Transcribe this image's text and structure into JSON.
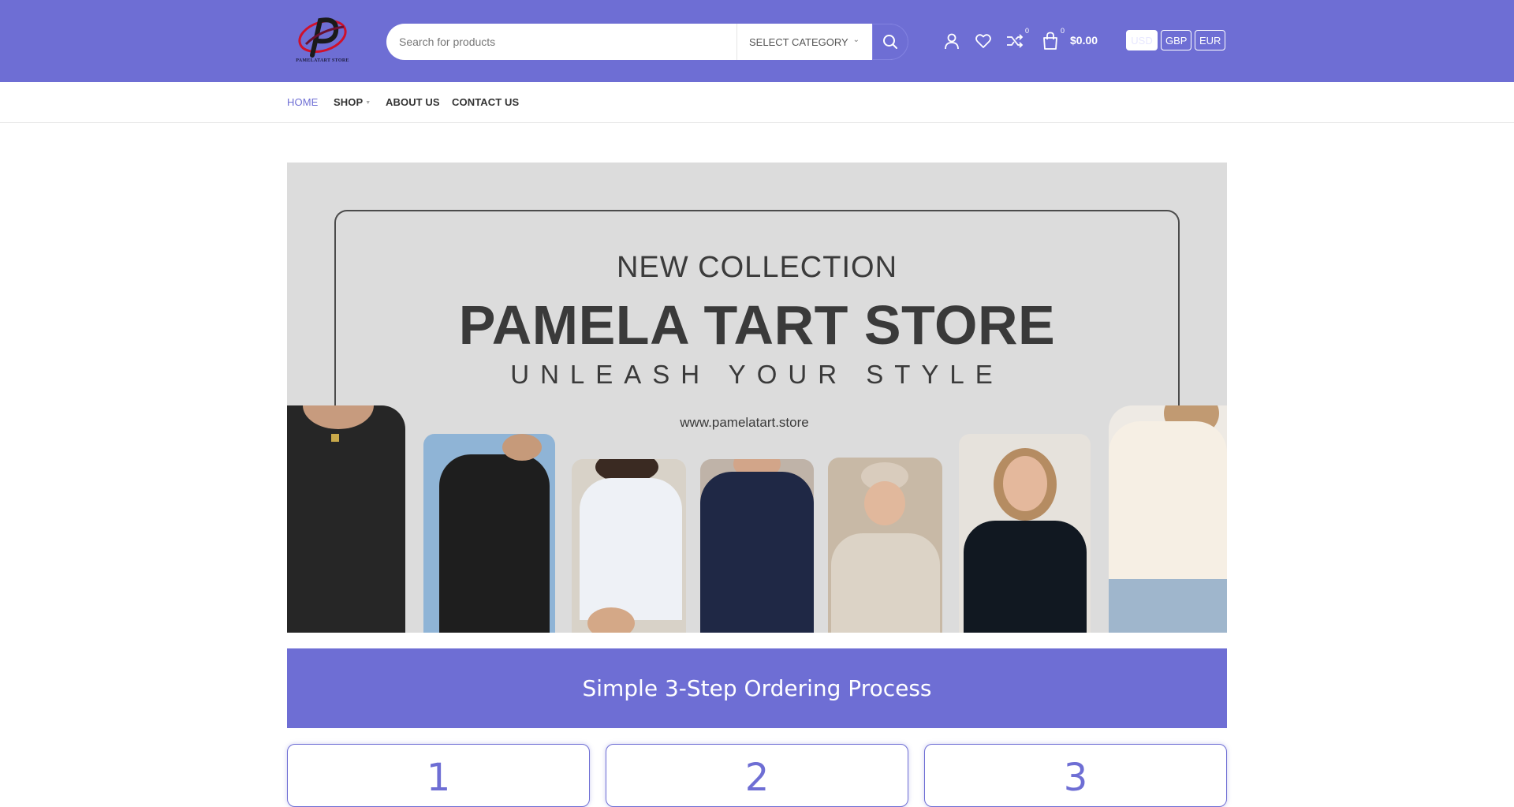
{
  "header": {
    "logo_text": "PAMELATART STORE",
    "search": {
      "placeholder": "Search for products"
    },
    "category_select": {
      "selected": "SELECT CATEGORY"
    },
    "compare_count": "0",
    "cart_count": "0",
    "cart_total": "$0.00",
    "currencies": [
      {
        "label": "USD",
        "active": true
      },
      {
        "label": "GBP",
        "active": false
      },
      {
        "label": "EUR",
        "active": false
      }
    ],
    "accent_color": "#6e6ed4"
  },
  "nav": {
    "items": [
      {
        "label": "HOME",
        "active": true
      },
      {
        "label": "SHOP",
        "has_submenu": true
      },
      {
        "label": "ABOUT US"
      },
      {
        "label": "CONTACT US"
      }
    ]
  },
  "hero": {
    "kicker": "NEW COLLECTION",
    "title": "PAMELA TART STORE",
    "subtitle": "UNLEASH YOUR STYLE",
    "url": "www.pamelatart.store"
  },
  "steps": {
    "title": "Simple 3-Step Ordering Process",
    "items": [
      {
        "number": "1"
      },
      {
        "number": "2"
      },
      {
        "number": "3"
      }
    ]
  },
  "icons": [
    "search-icon",
    "user-icon",
    "heart-icon",
    "compare-icon",
    "cart-icon",
    "chevron-down-icon"
  ]
}
